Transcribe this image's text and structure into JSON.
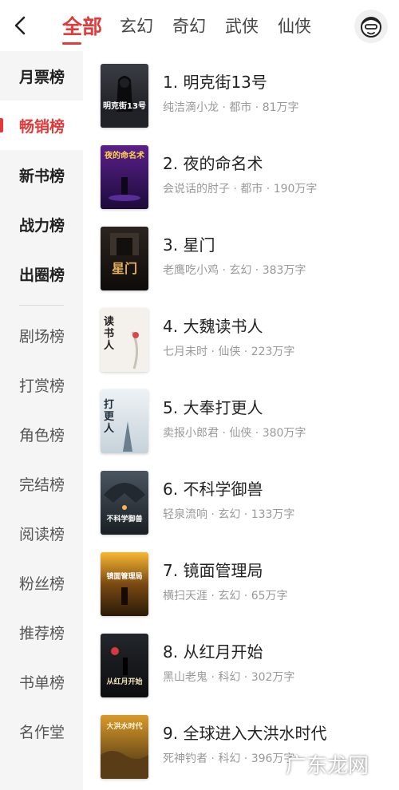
{
  "header": {
    "tabs": [
      {
        "label": "全部"
      },
      {
        "label": "玄幻"
      },
      {
        "label": "奇幻"
      },
      {
        "label": "武侠"
      },
      {
        "label": "仙侠"
      }
    ],
    "back_icon": "chevron-left-icon",
    "avatar_icon": "user-avatar-icon"
  },
  "sidebar": {
    "items": [
      {
        "label": "月票榜"
      },
      {
        "label": "畅销榜"
      },
      {
        "label": "新书榜"
      },
      {
        "label": "战力榜"
      },
      {
        "label": "出圈榜"
      },
      {
        "label": "剧场榜"
      },
      {
        "label": "打赏榜"
      },
      {
        "label": "角色榜"
      },
      {
        "label": "完结榜"
      },
      {
        "label": "阅读榜"
      },
      {
        "label": "粉丝榜"
      },
      {
        "label": "推荐榜"
      },
      {
        "label": "书单榜"
      },
      {
        "label": "名作堂"
      }
    ]
  },
  "books": [
    {
      "title": "1. 明克街13号",
      "meta": "纯洁滴小龙 · 都市 · 81万字"
    },
    {
      "title": "2. 夜的命名术",
      "meta": "会说话的肘子 · 都市 · 190万字"
    },
    {
      "title": "3. 星门",
      "meta": "老鹰吃小鸡 · 玄幻 · 383万字"
    },
    {
      "title": "4. 大魏读书人",
      "meta": "七月未时 · 仙侠 · 223万字"
    },
    {
      "title": "5. 大奉打更人",
      "meta": "卖报小郎君 · 仙侠 · 380万字"
    },
    {
      "title": "6. 不科学御兽",
      "meta": "轻泉流响 · 玄幻 · 133万字"
    },
    {
      "title": "7. 镜面管理局",
      "meta": "横扫天涯 · 玄幻 · 65万字"
    },
    {
      "title": "8. 从红月开始",
      "meta": "黑山老鬼 · 科幻 · 302万字"
    },
    {
      "title": "9. 全球进入大洪水时代",
      "meta": "死神钓者 · 科幻 · 396万字"
    }
  ],
  "covers": [
    {
      "text": "明克街13号"
    },
    {
      "text": "夜的命名术"
    },
    {
      "text": "星门"
    },
    {
      "text": "读书人"
    },
    {
      "text": "打更人"
    },
    {
      "text": "不科学御兽"
    },
    {
      "text": "镜面管理局"
    },
    {
      "text": "从红月开始"
    },
    {
      "text": "大洪水时代"
    }
  ],
  "watermark": "广东龙网",
  "colors": {
    "accent": "#e23a3a",
    "sidebar_bg": "#f5f5f5",
    "meta": "#999999"
  }
}
